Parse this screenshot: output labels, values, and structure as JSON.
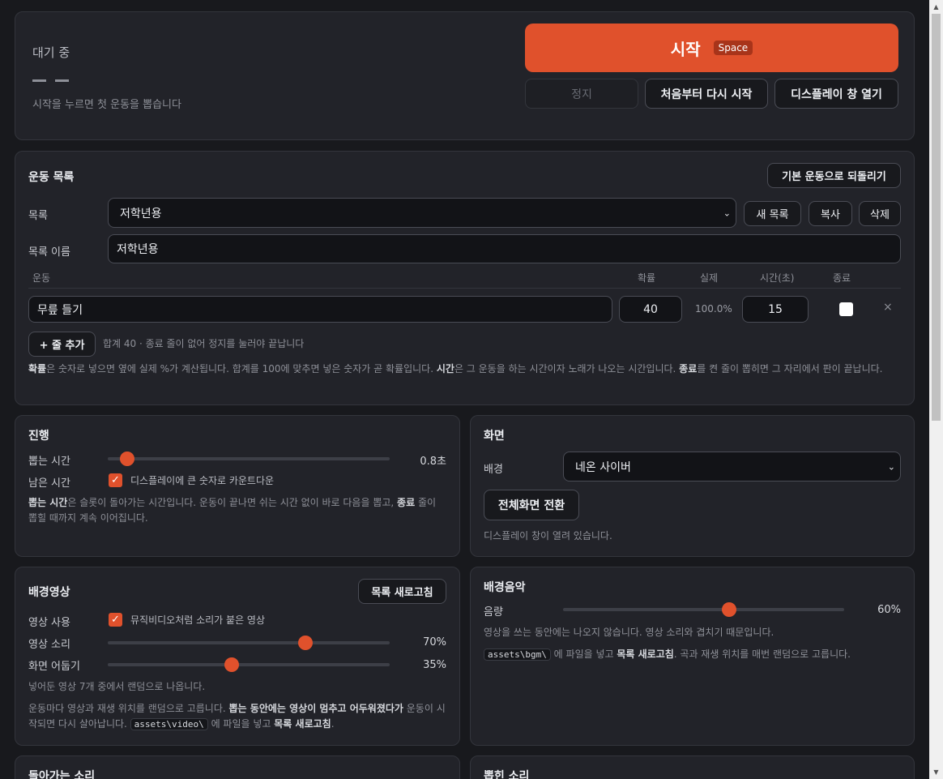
{
  "status": {
    "state": "대기 중",
    "dashes": "— —",
    "hint": "시작을 누르면 첫 운동을 뽑습니다"
  },
  "controls": {
    "start": "시작",
    "start_key": "Space",
    "stop": "정지",
    "restart": "처음부터 다시 시작",
    "display": "디스플레이 창 열기"
  },
  "list": {
    "title": "운동 목록",
    "reset": "기본 운동으로 되돌리기",
    "list_label": "목록",
    "list_value": "저학년용",
    "new_btn": "새 목록",
    "copy_btn": "복사",
    "delete_btn": "삭제",
    "name_label": "목록 이름",
    "name_value": "저학년용",
    "headers": {
      "exercise": "운동",
      "prob": "확률",
      "actual": "실제",
      "time": "시간(초)",
      "end": "종료"
    },
    "row": {
      "name": "무릎 들기",
      "prob": "40",
      "actual": "100.0%",
      "time": "15",
      "end": false,
      "remove": "×"
    },
    "add_btn": "+ 줄 추가",
    "summary": "합계 40 · 종료 줄이 없어 정지를 눌러야 끝납니다",
    "help": {
      "b1": "확률",
      "t1": "은 숫자로 넣으면 옆에 실제 %가 계산됩니다. 합계를 100에 맞추면 넣은 숫자가 곧 확률입니다. ",
      "b2": "시간",
      "t2": "은 그 운동을 하는 시간이자 노래가 나오는 시간입니다. ",
      "b3": "종료",
      "t3": "를 켠 줄이 뽑히면 그 자리에서 판이 끝납니다."
    }
  },
  "progress": {
    "title": "진행",
    "draw_label": "뽑는 시간",
    "draw_value": "0.8초",
    "draw_level": 0.07,
    "remain_label": "남은 시간",
    "countdown": "디스플레이에 큰 숫자로 카운트다운",
    "help": {
      "b1": "뽑는 시간",
      "t1": "은 슬롯이 돌아가는 시간입니다. 운동이 끝나면 쉬는 시간 없이 바로 다음을 뽑고, ",
      "b2": "종료",
      "t2": " 줄이 뽑힐 때까지 계속 이어집니다."
    }
  },
  "screen": {
    "title": "화면",
    "bg_label": "배경",
    "bg_value": "네온 사이버",
    "fullscreen": "전체화면 전환",
    "status": "디스플레이 창이 열려 있습니다."
  },
  "video": {
    "title": "배경영상",
    "refresh": "목록 새로고침",
    "use_label": "영상 사용",
    "use_text": "뮤직비디오처럼 소리가 붙은 영상",
    "vol_label": "영상 소리",
    "vol_value": "70%",
    "vol_level": 0.7,
    "dim_label": "화면 어둡기",
    "dim_value": "35%",
    "dim_level": 0.44,
    "count_text": "넣어둔 영상 7개 중에서 랜덤으로 나옵니다.",
    "help": {
      "t1": "운동마다 영상과 재생 위치를 랜덤으로 고릅니다. ",
      "b1": "뽑는 동안에는 영상이 멈추고 어두워졌다가",
      "t2": " 운동이 시작되면 다시 살아납니다. ",
      "code": "assets\\video\\",
      "t3": " 에 파일을 넣고 ",
      "b2": "목록 새로고침",
      "t4": "."
    }
  },
  "music": {
    "title": "배경음악",
    "vol_label": "음량",
    "vol_value": "60%",
    "vol_level": 0.59,
    "note": "영상을 쓰는 동안에는 나오지 않습니다. 영상 소리와 겹치기 때문입니다.",
    "help": {
      "code": "assets\\bgm\\",
      "t1": " 에 파일을 넣고 ",
      "b1": "목록 새로고침",
      "t2": ". 곡과 재생 위치를 매번 랜덤으로 고릅니다."
    }
  },
  "bottom": {
    "spin_title": "돌아가는 소리",
    "picked_title": "뽑힌 소리"
  },
  "colors": {
    "accent": "#e0512c",
    "bg": "#18191d",
    "card": "#222329"
  }
}
